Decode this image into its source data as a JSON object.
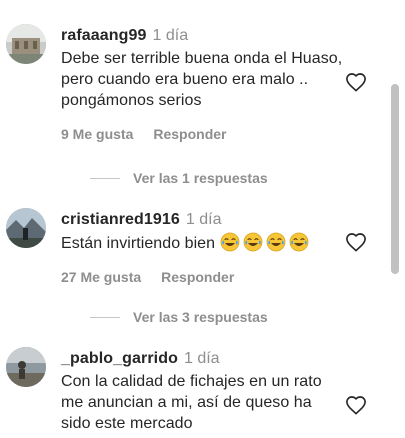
{
  "comments": [
    {
      "username": "rafaaang99",
      "time": "1 día",
      "text": "Debe ser terrible buena onda el Huaso, pero cuando era bueno era malo .. pongámonos serios",
      "likes": "9 Me gusta",
      "reply": "Responder",
      "replies": "Ver las 1 respuestas"
    },
    {
      "username": "cristianred1916",
      "time": "1 día",
      "text": "Están invirtiendo bien",
      "emojis": [
        "😂",
        "😂",
        "😂",
        "😂"
      ],
      "likes": "27 Me gusta",
      "reply": "Responder",
      "replies": "Ver las 3 respuestas"
    },
    {
      "username": "_pablo_garrido",
      "time": "1 día",
      "text": "Con la calidad de fichajes en un rato me anuncian a mi, así de queso ha sido este mercado"
    }
  ],
  "colors": {
    "text": "#262626",
    "muted": "#8e8e8e",
    "divider": "#c7c7c7"
  },
  "icons": {
    "like": "heart-outline-icon",
    "emoji": "face-with-tears-of-joy"
  }
}
